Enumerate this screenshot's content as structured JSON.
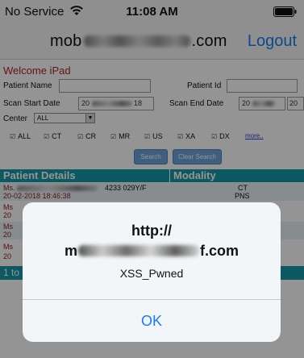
{
  "status_bar": {
    "carrier": "No Service",
    "time": "11:08 AM"
  },
  "nav": {
    "title_start": "mob",
    "title_end": ".com",
    "logout": "Logout"
  },
  "page": {
    "welcome": "Welcome iPad",
    "labels": {
      "patient_name": "Patient Name",
      "patient_id": "Patient Id",
      "scan_start": "Scan Start Date",
      "scan_end": "Scan End Date",
      "center": "Center"
    },
    "scan_start_value_start": "20",
    "scan_start_value_end": "18",
    "scan_end_value_start": "20",
    "scan_end_value_end": "20",
    "center_value": "ALL",
    "modalities": [
      "ALL",
      "CT",
      "CR",
      "MR",
      "US",
      "XA",
      "DX"
    ],
    "more": "more..",
    "search_button": "Search",
    "clear_button": "Clear Search",
    "grid": {
      "col1": "Patient Details",
      "col2": "Modality",
      "row1_name_start": "Ms.",
      "row1_id": "4233 029Y/F",
      "row1_date": "20-02-2018 18:46:38",
      "row1_modality": "CT",
      "row1_modality2": "PNS",
      "row_name_start": "Ms",
      "row_date_start": "20",
      "footer": "1 to"
    }
  },
  "alert": {
    "title_line1": "http://",
    "title_line2_start": "m",
    "title_line2_end": "f.com",
    "message": "XSS_Pwned",
    "ok": "OK"
  },
  "colors": {
    "accent": "#1a7cf2",
    "teal_header": "#189aaa",
    "welcome_red": "#b22424"
  }
}
